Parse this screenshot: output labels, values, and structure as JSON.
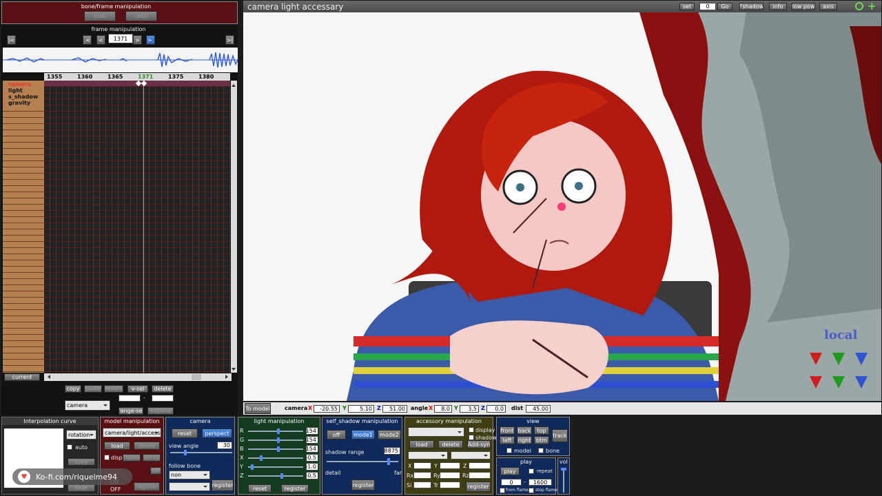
{
  "left_panel": {
    "title": "bone/frame manipulation",
    "undo": "undo",
    "redo": "redo",
    "frame_title": "frame manipulation",
    "frame_value": "1371",
    "nav": {
      "first": "|<",
      "prev_key": ".<",
      "prev": "<",
      "next": ">",
      "next_key": ">.",
      "last": ">|"
    },
    "ruler": [
      "1355",
      "1360",
      "1365",
      "1371",
      "1375",
      "1380"
    ],
    "tracks": [
      "camera",
      "light",
      "s_shadow",
      "gravity"
    ],
    "current": "current",
    "buttons": {
      "copy": "copy",
      "paste": "paste",
      "revers": "revers",
      "vsel": "v-sel",
      "delete": "delete",
      "range_sel": "range-sel",
      "expand": "expand"
    },
    "mode_select": "camera",
    "range_dash": "-"
  },
  "viewport": {
    "title": "camera light accessary",
    "set": "set",
    "set_value": "0",
    "go": "Go",
    "fshadow": "Fshadow",
    "info": "info",
    "low_pow": "low pow",
    "axis": "axis",
    "local": "local",
    "gizmo_x": "X",
    "gizmo_y": "Y",
    "gizmo_z": "Z"
  },
  "coords": {
    "to_model": "To model",
    "camera_label": "camera",
    "x_label": "X",
    "x": "-20.55",
    "y_label": "Y",
    "y": "5.10",
    "z_label": "Z",
    "z": "51.00",
    "angle_label": "angle",
    "ax": "8.0",
    "ay": "3.5",
    "az": "0.0",
    "dist_label": "dist",
    "dist": "45.00"
  },
  "interp": {
    "title": "Interpolation curve",
    "select": "rotation",
    "auto": "auto",
    "copy": "copy",
    "liner": "liner"
  },
  "model": {
    "title": "model manipulation",
    "select": "camera/light/accesso",
    "load": "load",
    "delete": "delete",
    "disp": "disp",
    "shadow": "shadow",
    "addsyn": "add-syn",
    "op": "OP",
    "register": "register",
    "on": "ON",
    "off": "OFF"
  },
  "camera": {
    "title": "camera",
    "reset": "reset",
    "perspect": "perspect",
    "view_angle": "view angle",
    "view_angle_value": "30",
    "follow_bone": "follow bone",
    "follow_select": "non",
    "register": "register"
  },
  "light": {
    "title": "light manipulation",
    "rows": [
      {
        "label": "R",
        "value": "154"
      },
      {
        "label": "G",
        "value": "154"
      },
      {
        "label": "B",
        "value": "154"
      },
      {
        "label": "X",
        "value": "-0.5"
      },
      {
        "label": "Y",
        "value": "-1.0"
      },
      {
        "label": "Z",
        "value": "+0.5"
      }
    ],
    "reset": "reset",
    "register": "register"
  },
  "self_shadow": {
    "title": "self_shadow manipulation",
    "off": "off",
    "mode1": "mode1",
    "mode2": "mode2",
    "range_label": "shadow range",
    "range_value": "8875",
    "detail": "detail",
    "far": "far",
    "register": "register"
  },
  "accessory": {
    "title": "accessory manipulation",
    "display": "display",
    "shadow": "shadow",
    "load": "load",
    "delete": "delete",
    "addsyn": "Add-syn",
    "labels": {
      "x": "X",
      "y": "Y",
      "z": "Z",
      "rx": "Rx",
      "ry": "Ry",
      "rz": "Rz",
      "si": "Si",
      "tr": "Tr"
    },
    "register": "register"
  },
  "view": {
    "title": "view",
    "front": "front",
    "back": "back",
    "top": "top",
    "left": "left",
    "right": "right",
    "btm": "btm",
    "track": "track",
    "model": "model",
    "bone": "bone"
  },
  "play": {
    "title": "play",
    "play": "play",
    "repeat": "repeat",
    "from": "0",
    "dash": "-",
    "to": "1600",
    "from_flame": "from flame",
    "stop_flame": "stop flame"
  },
  "vol": {
    "title": "vol"
  },
  "watermark": "Ko-fi.com/riquelme94",
  "colors": {
    "panel_red": "#5a0f14",
    "panel_blue": "#0f2a5a",
    "panel_green": "#143c20",
    "panel_olive": "#3e3e12",
    "accent_blue": "#2a5fb4"
  }
}
